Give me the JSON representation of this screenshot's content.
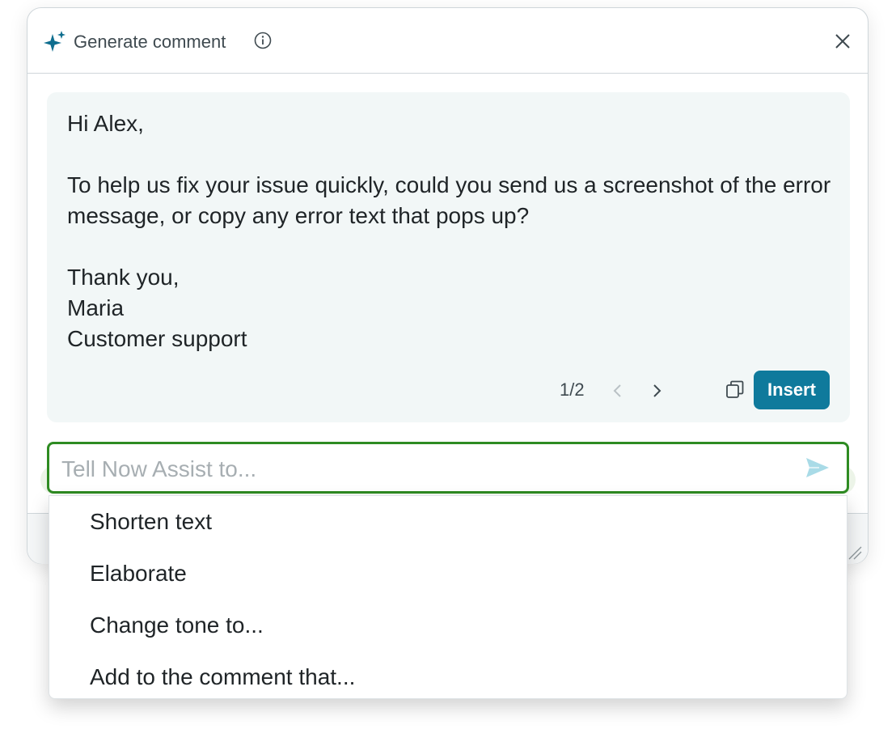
{
  "header": {
    "title": "Generate comment",
    "icons": [
      "sparkle-icon",
      "info-icon",
      "close-icon"
    ],
    "accent_color": "#0f6e8f"
  },
  "message": {
    "text": "Hi Alex,\n\nTo help us fix your issue quickly, could you send us a screenshot of the error message, or copy any error text that pops up?\n\nThank you,\nMaria\nCustomer support",
    "pager": "1/2",
    "insert_label": "Insert",
    "insert_color": "#0f7a9c"
  },
  "prompt": {
    "placeholder": "Tell Now Assist to...",
    "value": "",
    "border_color": "#2e8b22"
  },
  "suggestions": [
    {
      "label": "Shorten text"
    },
    {
      "label": "Elaborate"
    },
    {
      "label": "Change tone to..."
    },
    {
      "label": "Add to the comment that..."
    }
  ]
}
